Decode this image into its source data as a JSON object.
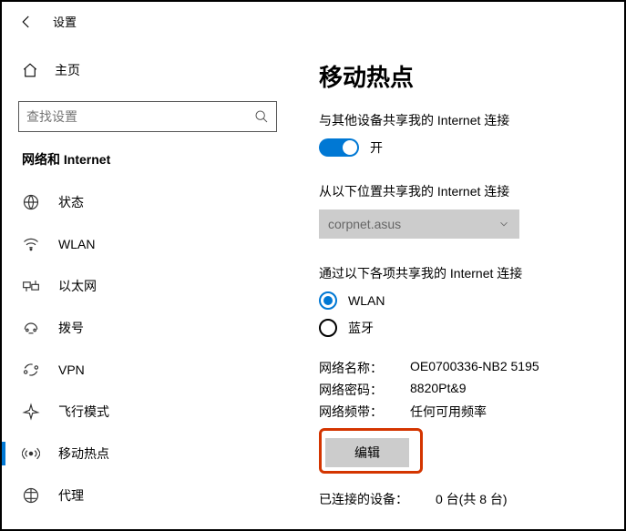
{
  "header": {
    "title": "设置"
  },
  "sidebar": {
    "home_label": "主页",
    "search_placeholder": "查找设置",
    "heading": "网络和 Internet",
    "items": [
      {
        "label": "状态"
      },
      {
        "label": "WLAN"
      },
      {
        "label": "以太网"
      },
      {
        "label": "拨号"
      },
      {
        "label": "VPN"
      },
      {
        "label": "飞行模式"
      },
      {
        "label": "移动热点"
      },
      {
        "label": "代理"
      }
    ]
  },
  "main": {
    "title": "移动热点",
    "share_label": "与其他设备共享我的 Internet 连接",
    "toggle_state": "开",
    "share_from_label": "从以下位置共享我的 Internet 连接",
    "share_from_value": "corpnet.asus",
    "share_over_label": "通过以下各项共享我的 Internet 连接",
    "radio_wlan": "WLAN",
    "radio_bt": "蓝牙",
    "info": {
      "net_name_label": "网络名称：",
      "net_name_value": "OE0700336-NB2 5195",
      "net_pass_label": "网络密码：",
      "net_pass_value": "8820Pt&9",
      "net_band_label": "网络频带：",
      "net_band_value": "任何可用频率"
    },
    "edit_button": "编辑",
    "connected_label": "已连接的设备：",
    "connected_value": "0 台(共 8 台)"
  }
}
